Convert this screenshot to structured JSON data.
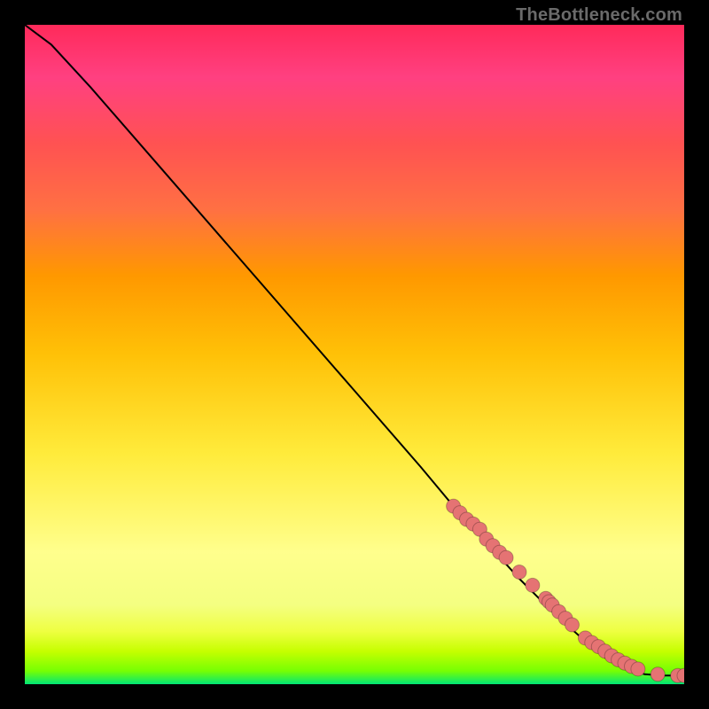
{
  "attribution": "TheBottleneck.com",
  "colors": {
    "dot_fill": "#e57373",
    "curve_stroke": "#000000"
  },
  "chart_data": {
    "type": "line",
    "title": "",
    "xlabel": "",
    "ylabel": "",
    "xlim": [
      0,
      100
    ],
    "ylim": [
      0,
      100
    ],
    "grid": false,
    "legend": false,
    "note": "Axes have no visible tick labels; values are estimated on a 0–100 normalized scale from pixel positions. Curve starts near top-left and descends to a floor near bottom-right. Scatter points cluster along the lower-right segment of the curve.",
    "curve": {
      "x": [
        0,
        4,
        10,
        20,
        30,
        40,
        50,
        60,
        65,
        70,
        75,
        80,
        85,
        88,
        91,
        94,
        97,
        100
      ],
      "y": [
        100,
        97,
        90.5,
        79,
        67.5,
        56,
        44.5,
        33,
        27,
        21.5,
        16,
        11,
        6.5,
        4,
        2.5,
        1.5,
        1.3,
        1.3
      ]
    },
    "scatter": {
      "x": [
        65,
        66,
        67,
        68,
        69,
        70,
        71,
        72,
        73,
        75,
        77,
        79,
        79.5,
        80,
        81,
        82,
        83,
        85,
        86,
        87,
        88,
        89,
        90,
        91,
        92,
        93,
        96,
        99,
        100
      ],
      "y": [
        27,
        26,
        25,
        24.3,
        23.5,
        22,
        21,
        20,
        19.2,
        17,
        15,
        13,
        12.5,
        12,
        11,
        10,
        9,
        7,
        6.3,
        5.7,
        5,
        4.3,
        3.7,
        3.2,
        2.7,
        2.3,
        1.5,
        1.3,
        1.3
      ]
    }
  }
}
